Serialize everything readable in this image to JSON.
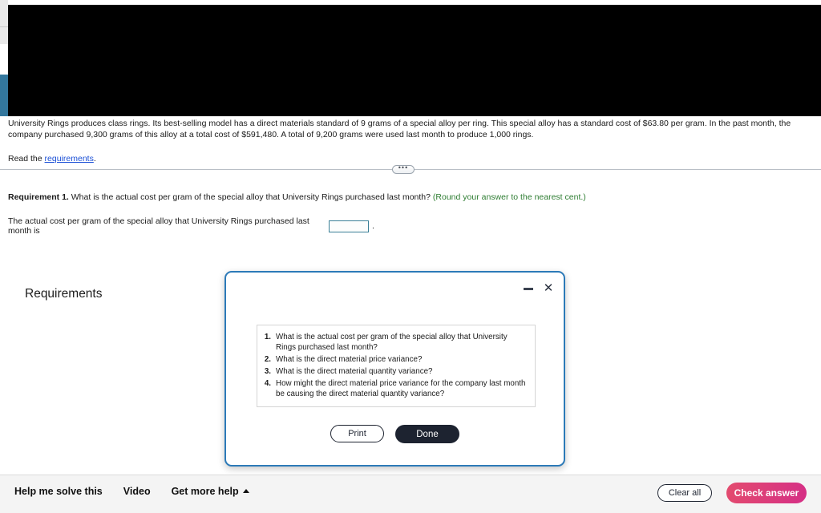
{
  "problem": {
    "paragraph": "University Rings produces class rings. Its best-selling model has a direct materials standard of 9 grams of a special alloy per ring. This special alloy has a standard cost of $63.80 per gram. In the past month, the company purchased 9,300 grams of this alloy at a total cost of $591,480. A total of 9,200 grams were used last month to produce 1,000 rings.",
    "read_prefix": "Read the ",
    "read_link": "requirements",
    "read_suffix": "."
  },
  "splitter": {
    "handle_glyph": "•••"
  },
  "requirement": {
    "label": "Requirement 1.",
    "question": " What is the actual cost per gram of the special alloy that University Rings purchased last month? ",
    "round_note": "(Round your answer to the nearest cent.)",
    "answer_label": "The actual cost per gram of the special alloy that University Rings purchased last month is",
    "answer_value": "",
    "answer_period": "."
  },
  "modal": {
    "title": "Requirements",
    "minimize_icon": "minimize-icon",
    "close_icon": "close-icon",
    "items": [
      {
        "num": "1.",
        "text": "What is the actual cost per gram of the special alloy that University Rings purchased last month?"
      },
      {
        "num": "2.",
        "text": "What is the direct material price variance?"
      },
      {
        "num": "3.",
        "text": "What is the direct material quantity variance?"
      },
      {
        "num": "4.",
        "text": "How might the direct material price variance for the company last month be causing the direct material quantity variance?"
      }
    ],
    "print_label": "Print",
    "done_label": "Done"
  },
  "toolbar": {
    "help_label": "Help me solve this",
    "video_label": "Video",
    "more_help_label": "Get more help",
    "clear_label": "Clear all",
    "check_label": "Check answer"
  },
  "colors": {
    "modal_border": "#2c7ab8",
    "accent_teal": "#33779d",
    "link_blue": "#1a4fd6",
    "note_green": "#2e7d32",
    "check_gradient_start": "#e34b6e",
    "check_gradient_end": "#d52f86"
  }
}
